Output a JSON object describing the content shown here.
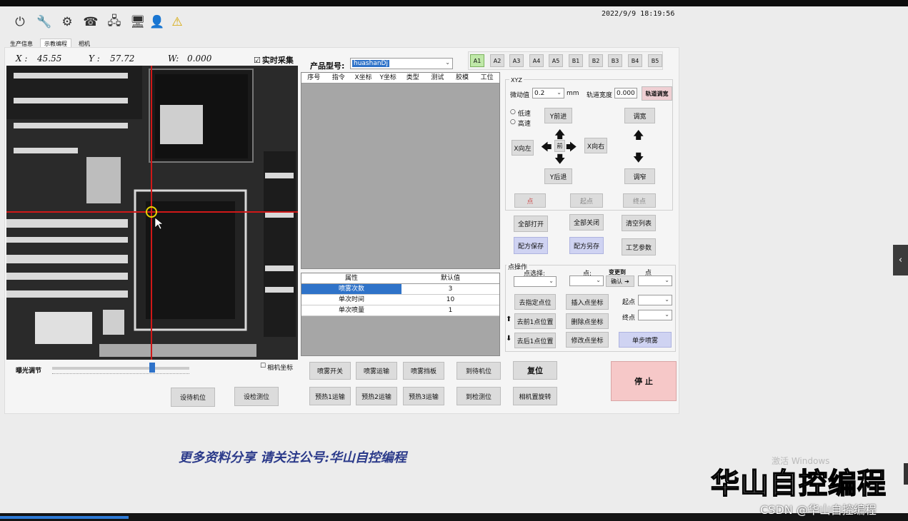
{
  "toolbar": {
    "icons": [
      "power-icon",
      "wrench-icon",
      "gear-icon",
      "phone-icon",
      "network-icon",
      "monitor-icon",
      "user-icon",
      "warning-icon"
    ],
    "datetime": "2022/9/9  18:19:56"
  },
  "tabs": [
    "生产信息",
    "示教编程",
    "相机"
  ],
  "coords": {
    "x_label": "X :",
    "x_value": "45.55",
    "y_label": "Y :",
    "y_value": "57.72",
    "w_label": "W:",
    "w_value": "0.000"
  },
  "realtime": {
    "label": "实时采集",
    "checked": true
  },
  "product": {
    "label": "产品型号:",
    "value": "huashanDj"
  },
  "slots": [
    "A1",
    "A2",
    "A3",
    "A4",
    "A5",
    "B1",
    "B2",
    "B3",
    "B4",
    "B5"
  ],
  "grid_headers": [
    "序号",
    "指令",
    "X坐标",
    "Y坐标",
    "类型",
    "测试",
    "胶模",
    "工位"
  ],
  "params": {
    "headers": [
      "属性",
      "默认值"
    ],
    "rows": [
      {
        "name": "喷雾次数",
        "value": "3"
      },
      {
        "name": "单次时间",
        "value": "10"
      },
      {
        "name": "单次喷量",
        "value": "1"
      }
    ]
  },
  "xyz": {
    "title": "XYZ",
    "step_label": "微动值",
    "step_value": "0.2",
    "step_unit": "mm",
    "track_label": "轨道宽度",
    "track_value": "0.000",
    "track_button": "轨道调宽",
    "speed_low": "低速",
    "speed_high": "高速",
    "y_forward": "Y前进",
    "y_back": "Y后退",
    "x_left": "X向左",
    "x_right": "X向右",
    "center": "前",
    "widen": "调宽",
    "narrow": "调窄",
    "point": "点",
    "start_point": "起点",
    "end_point": "终点"
  },
  "actions": {
    "open_all": "全部打开",
    "close_all": "全部关闭",
    "clear_list": "清空列表",
    "save_recipe": "配方保存",
    "save_as": "配方另存",
    "process_params": "工艺参数"
  },
  "point_ops": {
    "title": "点操作",
    "point_select": "点选择:",
    "point": "点:",
    "change_to": "变更到",
    "point2": "点",
    "confirm": "确认",
    "goto_point": "去指定点位",
    "insert_coord": "插入点坐标",
    "start": "起点",
    "goto_prev": "去前1点位置",
    "delete_coord": "删除点坐标",
    "end": "终点",
    "goto_next": "去后1点位置",
    "modify_coord": "修改点坐标",
    "single_spray": "单步喷雾"
  },
  "camera": {
    "exposure_label": "曝光调节",
    "exposure_level": 0.73,
    "camera_coords_label": "相机坐标",
    "camera_coords_checked": false,
    "set_standby": "设待机位",
    "set_inspect": "设检测位"
  },
  "bottom": {
    "spray_switch": "喷雾开关",
    "spray_run": "喷雾运输",
    "spray_baffle": "喷雾挡板",
    "to_standby": "到待机位",
    "reset": "复位",
    "preheat1": "预热1运输",
    "preheat2": "预热2运输",
    "preheat3": "预热3运输",
    "to_inspect": "到检测位",
    "camera_rotate": "相机置旋转",
    "stop": "停 止"
  },
  "overlay": {
    "promo": "更多资料分享  请关注公号:华山自控编程",
    "brand": "华山自控编程",
    "csdn": "CSDN @华山自控编程",
    "windows": "激活 Windows"
  },
  "colors": {
    "accent": "#2f73c9",
    "stop": "#f6c8c8",
    "slot_active": "#bfe8a8",
    "crosshair": "#d01818",
    "marker": "#e8d400"
  }
}
